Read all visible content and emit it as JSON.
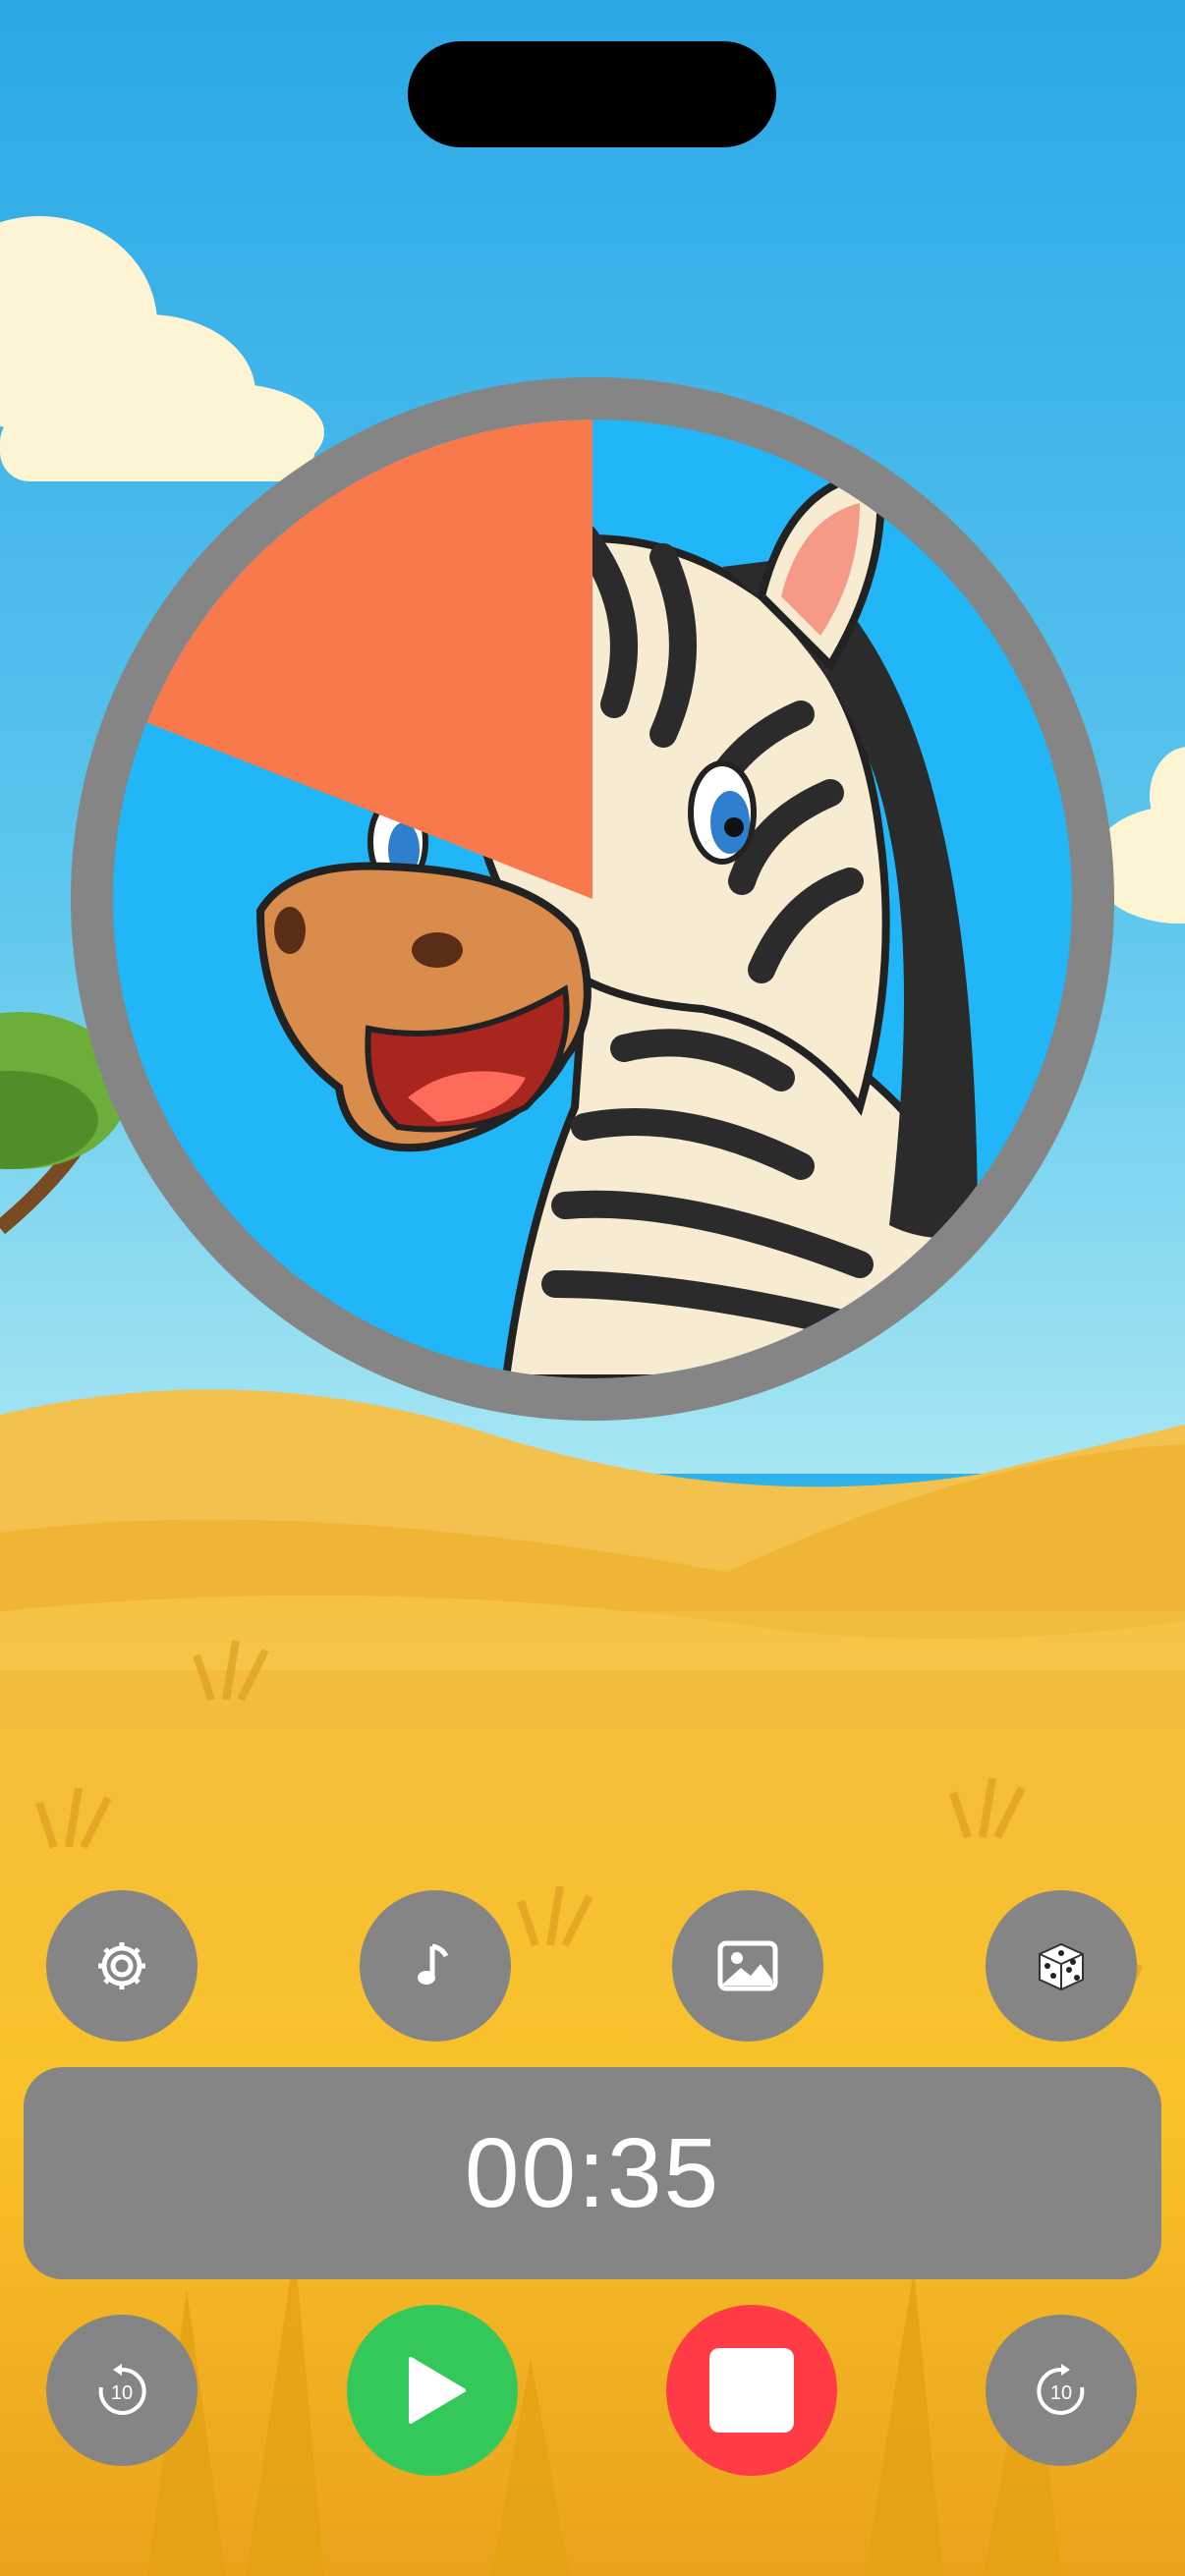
{
  "timer": {
    "display": "00:35",
    "elapsed_fraction": 0.19
  },
  "top_buttons": [
    {
      "name": "settings-button",
      "icon": "gear-icon"
    },
    {
      "name": "music-button",
      "icon": "music-note-icon"
    },
    {
      "name": "image-button",
      "icon": "image-icon"
    },
    {
      "name": "random-button",
      "icon": "dice-icon"
    }
  ],
  "bottom_buttons": {
    "rewind": {
      "icon": "rewind-10-icon",
      "label": "10"
    },
    "play": {
      "icon": "play-icon"
    },
    "stop": {
      "icon": "stop-icon"
    },
    "forward": {
      "icon": "forward-10-icon",
      "label": "10"
    }
  },
  "colors": {
    "timer_wedge": "#f87a4c",
    "ring": "#858585",
    "face_bg": "#20b6f7",
    "play": "#34c759",
    "stop": "#ff3b45"
  }
}
